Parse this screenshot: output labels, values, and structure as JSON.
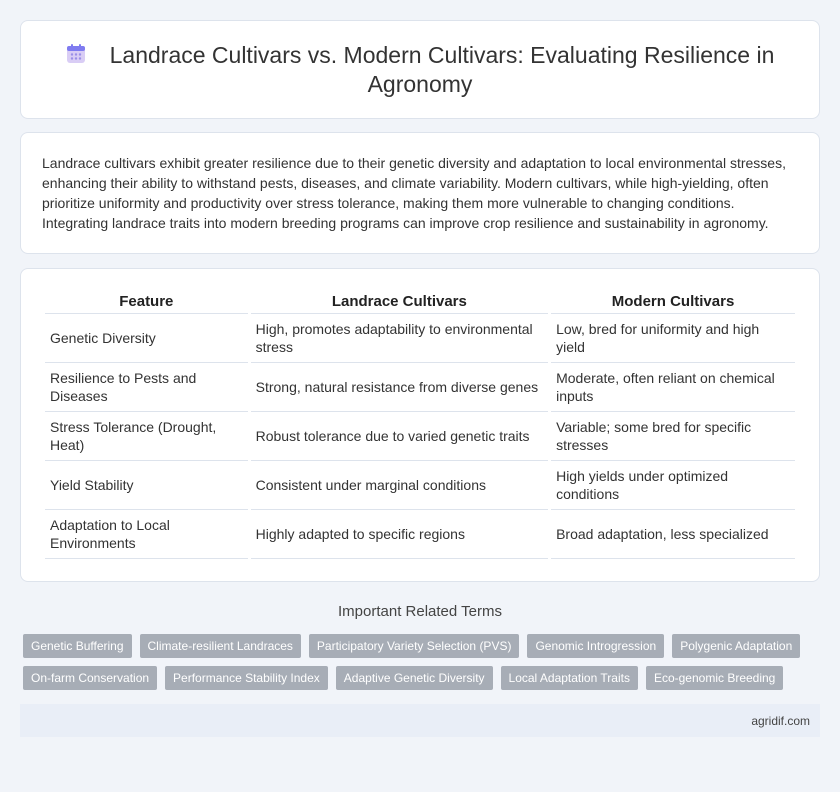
{
  "header": {
    "title": "Landrace Cultivars vs. Modern Cultivars: Evaluating Resilience in Agronomy",
    "icon": "calendar-icon"
  },
  "intro": {
    "text": "Landrace cultivars exhibit greater resilience due to their genetic diversity and adaptation to local environmental stresses, enhancing their ability to withstand pests, diseases, and climate variability. Modern cultivars, while high-yielding, often prioritize uniformity and productivity over stress tolerance, making them more vulnerable to changing conditions. Integrating landrace traits into modern breeding programs can improve crop resilience and sustainability in agronomy."
  },
  "table": {
    "headers": [
      "Feature",
      "Landrace Cultivars",
      "Modern Cultivars"
    ],
    "rows": [
      [
        "Genetic Diversity",
        "High, promotes adaptability to environmental stress",
        "Low, bred for uniformity and high yield"
      ],
      [
        "Resilience to Pests and Diseases",
        "Strong, natural resistance from diverse genes",
        "Moderate, often reliant on chemical inputs"
      ],
      [
        "Stress Tolerance (Drought, Heat)",
        "Robust tolerance due to varied genetic traits",
        "Variable; some bred for specific stresses"
      ],
      [
        "Yield Stability",
        "Consistent under marginal conditions",
        "High yields under optimized conditions"
      ],
      [
        "Adaptation to Local Environments",
        "Highly adapted to specific regions",
        "Broad adaptation, less specialized"
      ]
    ]
  },
  "related": {
    "title": "Important Related Terms",
    "tags": [
      "Genetic Buffering",
      "Climate-resilient Landraces",
      "Participatory Variety Selection (PVS)",
      "Genomic Introgression",
      "Polygenic Adaptation",
      "On-farm Conservation",
      "Performance Stability Index",
      "Adaptive Genetic Diversity",
      "Local Adaptation Traits",
      "Eco-genomic Breeding"
    ]
  },
  "footer": {
    "site": "agridif.com"
  }
}
